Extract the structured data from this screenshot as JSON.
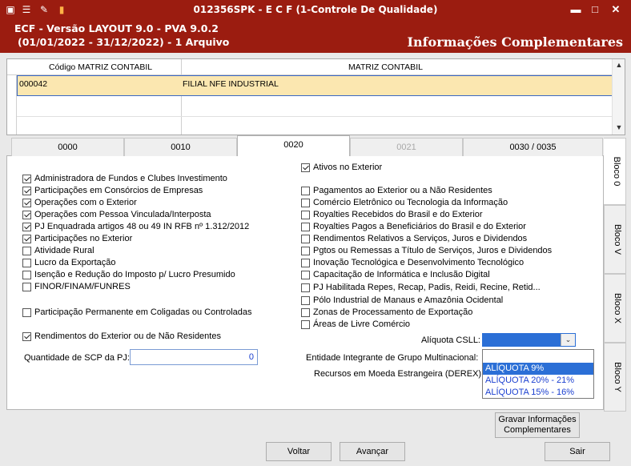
{
  "window": {
    "title": "012356SPK - E C F (1-Controle De Qualidade)",
    "minimize_glyph": "▬",
    "maximize_glyph": "□",
    "close_glyph": "✕"
  },
  "header": {
    "line1": "ECF - Versão LAYOUT 9.0 - PVA 9.0.2",
    "line2": "(01/01/2022 - 31/12/2022) - 1 Arquivo",
    "right_title": "Informações Complementares"
  },
  "grid": {
    "col1_header": "Código MATRIZ CONTABIL",
    "col2_header": "MATRIZ CONTABIL",
    "rows": [
      {
        "code": "000042",
        "name": "FILIAL NFE INDUSTRIAL"
      }
    ]
  },
  "tabs": [
    "0000",
    "0010",
    "0020",
    "0021",
    "0030 / 0035"
  ],
  "side_tabs": [
    "Bloco 0",
    "Bloco V",
    "Bloco X",
    "Bloco Y"
  ],
  "left_checks": [
    {
      "label": "Administradora de Fundos e Clubes Investimento",
      "checked": true
    },
    {
      "label": "Participações em Consórcios de Empresas",
      "checked": true
    },
    {
      "label": "Operações com o Exterior",
      "checked": true
    },
    {
      "label": "Operações com Pessoa Vinculada/Interposta",
      "checked": true
    },
    {
      "label": "PJ Enquadrada artigos 48 ou 49 IN RFB nº 1.312/2012",
      "checked": true
    },
    {
      "label": "Participações no Exterior",
      "checked": true
    },
    {
      "label": "Atividade Rural",
      "checked": false
    },
    {
      "label": "Lucro da Exportação",
      "checked": false
    },
    {
      "label": "Isenção e Redução do Imposto p/ Lucro Presumido",
      "checked": false
    },
    {
      "label": "FINOR/FINAM/FUNRES",
      "checked": false
    },
    {
      "label": "Participação Permanente em Coligadas ou Controladas",
      "checked": false
    },
    {
      "label": "Rendimentos do Exterior ou de Não Residentes",
      "checked": true
    }
  ],
  "right_checks": [
    {
      "label": "Ativos no Exterior",
      "checked": true
    },
    {
      "label": "Pagamentos ao Exterior ou a Não Residentes",
      "checked": false
    },
    {
      "label": "Comércio Eletrônico ou Tecnologia da Informação",
      "checked": false
    },
    {
      "label": "Royalties Recebidos do Brasil e do Exterior",
      "checked": false
    },
    {
      "label": "Royalties Pagos a Beneficiários do Brasil e do Exterior",
      "checked": false
    },
    {
      "label": "Rendimentos Relativos a Serviços, Juros e Dividendos",
      "checked": false
    },
    {
      "label": "Pgtos ou Remessas a Título de Serviços, Juros e Dividendos",
      "checked": false
    },
    {
      "label": "Inovação Tecnológica e Desenvolvimento Tecnológico",
      "checked": false
    },
    {
      "label": "Capacitação de Informática e Inclusão Digital",
      "checked": false
    },
    {
      "label": "PJ Habilitada Repes, Recap, Padis, Reidi, Recine, Retid...",
      "checked": false
    },
    {
      "label": "Pólo Industrial de Manaus e Amazônia Ocidental",
      "checked": false
    },
    {
      "label": "Zonas de Processamento de Exportação",
      "checked": false
    },
    {
      "label": "Áreas de Livre Comércio",
      "checked": false
    }
  ],
  "fields": {
    "scp_label": "Quantidade de SCP da PJ:",
    "scp_value": "0",
    "csll_label": "Alíquota CSLL:",
    "multinacional_label": "Entidade Integrante de Grupo Multinacional:",
    "derex_label": "Recursos em Moeda Estrangeira (DEREX):"
  },
  "dropdown_options": [
    "ALÍQUOTA 9%",
    "ALÍQUOTA 20% - 21%",
    "ALÍQUOTA 15% - 16%"
  ],
  "buttons": {
    "gravar": "Gravar Informações Complementares",
    "gravar_line1": "Gravar Informações",
    "gravar_line2": "Complementares",
    "voltar": "Voltar",
    "avancar": "Avançar",
    "sair": "Sair"
  },
  "colors": {
    "title_bar": "#9b1c10",
    "selection": "#2b6fd6",
    "row_highlight": "#fbe7b0"
  }
}
